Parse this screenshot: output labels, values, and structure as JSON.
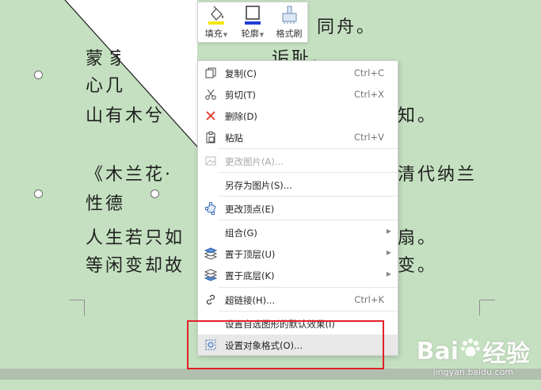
{
  "toolbar": {
    "fill_label": "填充",
    "outline_label": "轮廓",
    "format_painter_label": "格式刷",
    "fill_color": "#f5e50f",
    "outline_color": "#1f3fd6"
  },
  "poem": {
    "line1_tail": "同舟。",
    "line2_head": "蒙",
    "line2_tail": "诟耻。",
    "line3_head": "心几",
    "line4_head": "山有木兮",
    "line4_tail": "知。",
    "line5_head": "《木兰花·",
    "line5_tail": "清代纳兰",
    "line6": "性德",
    "line7_head": "人生若只如",
    "line7_tail": "扇。",
    "line8_head": "等闲变却故",
    "line8_tail": "变。"
  },
  "menu": {
    "items": [
      {
        "label": "复制(C)",
        "shortcut": "Ctrl+C",
        "icon": "copy-icon",
        "disabled": false,
        "submenu": false
      },
      {
        "label": "剪切(T)",
        "shortcut": "Ctrl+X",
        "icon": "scissors-icon",
        "disabled": false,
        "submenu": false
      },
      {
        "label": "删除(D)",
        "shortcut": "",
        "icon": "delete-x-icon",
        "disabled": false,
        "submenu": false
      },
      {
        "label": "粘贴",
        "shortcut": "Ctrl+V",
        "icon": "paste-icon",
        "disabled": false,
        "submenu": false
      },
      {
        "label": "更改图片(A)...",
        "shortcut": "",
        "icon": "change-picture-icon",
        "disabled": true,
        "submenu": false
      },
      {
        "label": "另存为图片(S)...",
        "shortcut": "",
        "icon": "",
        "disabled": false,
        "submenu": false
      },
      {
        "label": "更改顶点(E)",
        "shortcut": "",
        "icon": "edit-points-icon",
        "disabled": false,
        "submenu": false
      },
      {
        "label": "组合(G)",
        "shortcut": "",
        "icon": "",
        "disabled": false,
        "submenu": true
      },
      {
        "label": "置于顶层(U)",
        "shortcut": "",
        "icon": "bring-to-front-icon",
        "disabled": false,
        "submenu": true
      },
      {
        "label": "置于底层(K)",
        "shortcut": "",
        "icon": "send-to-back-icon",
        "disabled": false,
        "submenu": true
      },
      {
        "label": "超链接(H)...",
        "shortcut": "Ctrl+K",
        "icon": "hyperlink-icon",
        "disabled": false,
        "submenu": false
      },
      {
        "label": "设置自选图形的默认效果(I)",
        "shortcut": "",
        "icon": "",
        "disabled": false,
        "submenu": false
      },
      {
        "label": "设置对象格式(O)...",
        "shortcut": "",
        "icon": "format-object-icon",
        "disabled": false,
        "submenu": false
      }
    ]
  },
  "watermark": {
    "logo_left": "Bai",
    "logo_right": "经验",
    "url": "jingyan.baidu.com"
  }
}
